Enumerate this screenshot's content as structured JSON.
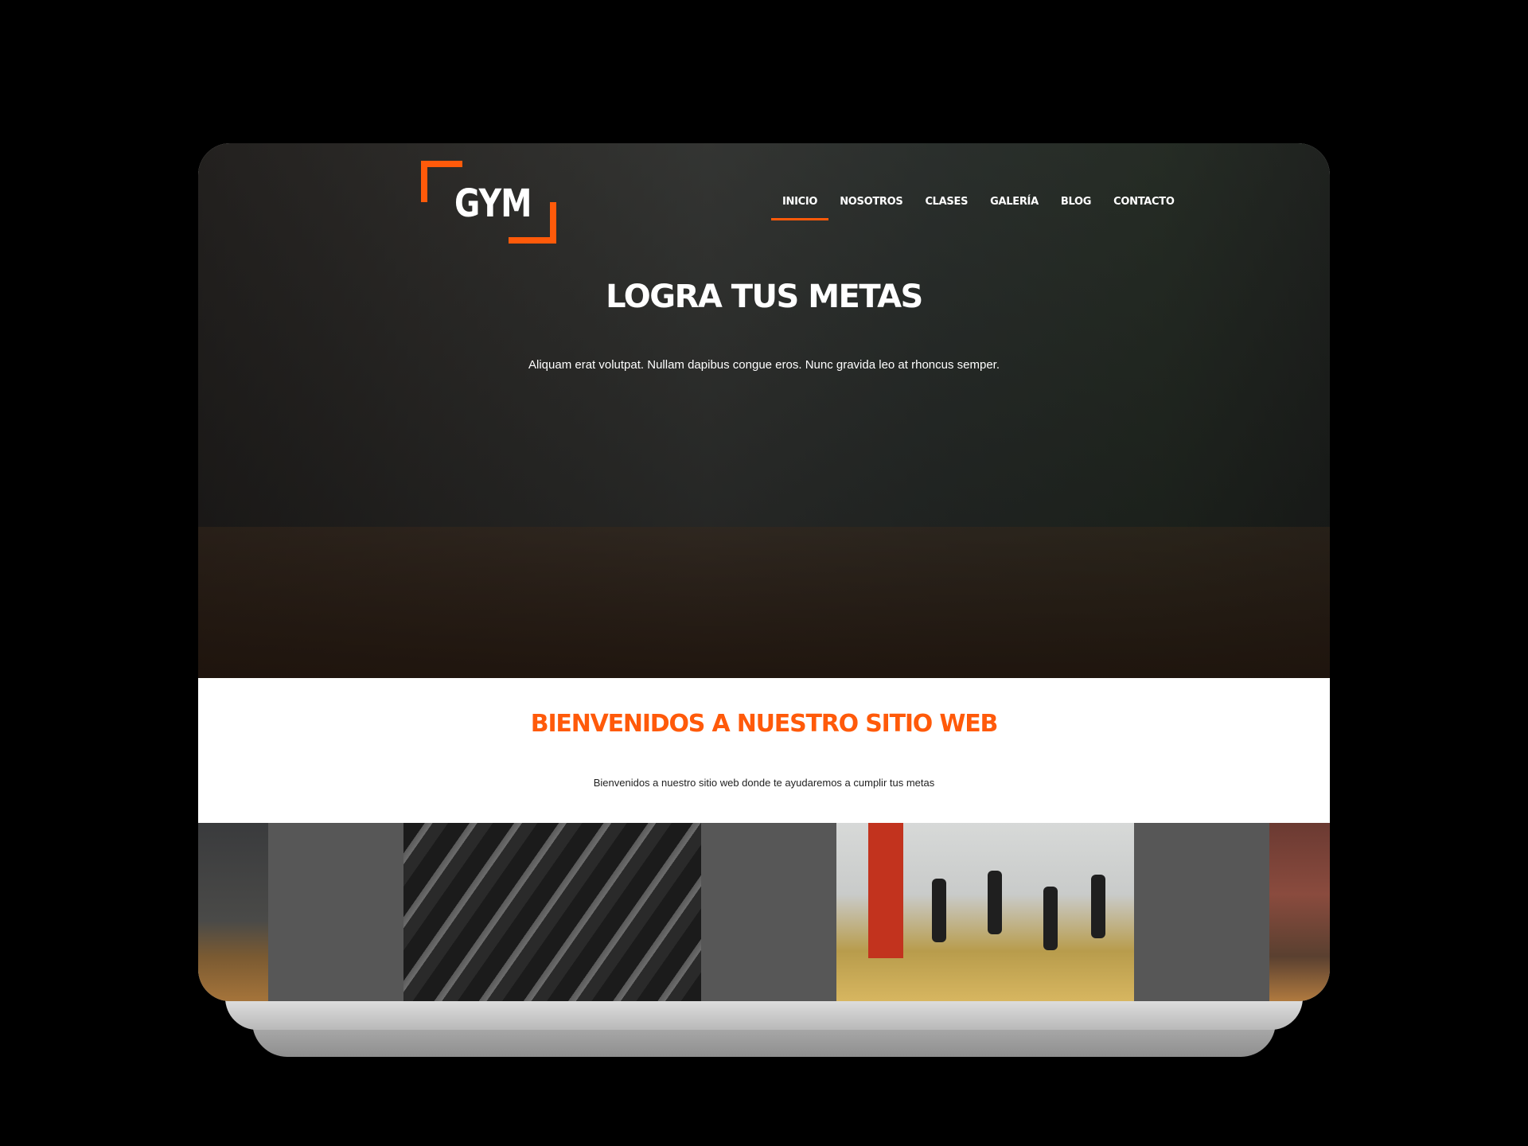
{
  "brand": {
    "logo_text": "GYM",
    "accent_color": "#ff5a0a"
  },
  "nav": {
    "items": [
      {
        "label": "INICIO",
        "active": true
      },
      {
        "label": "NOSOTROS",
        "active": false
      },
      {
        "label": "CLASES",
        "active": false
      },
      {
        "label": "GALERÍA",
        "active": false
      },
      {
        "label": "BLOG",
        "active": false
      },
      {
        "label": "CONTACTO",
        "active": false
      }
    ]
  },
  "hero": {
    "title": "LOGRA TUS METAS",
    "subtitle": "Aliquam erat volutpat. Nullam dapibus congue eros. Nunc gravida leo at rhoncus semper."
  },
  "welcome": {
    "title": "BIENVENIDOS A NUESTRO SITIO WEB",
    "text": "Bienvenidos a nuestro sitio web donde te ayudaremos a cumplir tus metas"
  }
}
